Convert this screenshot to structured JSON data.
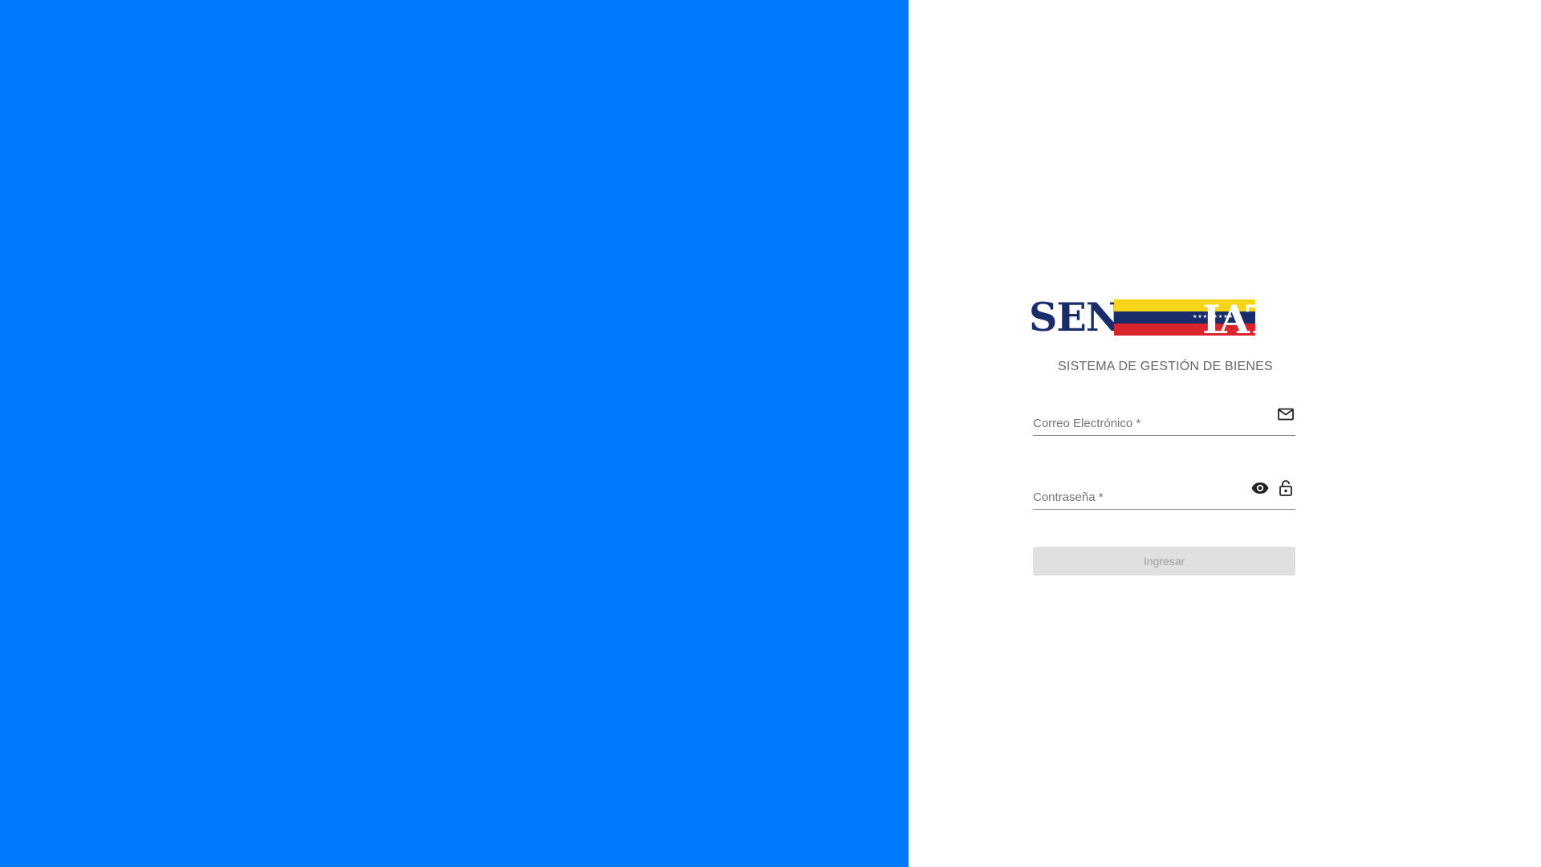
{
  "brand": {
    "logo_text_left": "SEN",
    "logo_text_right": "IAT",
    "logo_stars": "★★★★★★★★",
    "colors": {
      "navy": "#1a2d6b",
      "yellow": "#f7d417",
      "red": "#d9232d"
    }
  },
  "subtitle": "SISTEMA DE GESTIÓN DE BIENES",
  "form": {
    "email": {
      "label": "Correo Electrónico *",
      "value": "",
      "icon": "mail-icon"
    },
    "password": {
      "label": "Contraseña *",
      "value": "",
      "icons": [
        "eye-icon",
        "lock-icon"
      ]
    },
    "submit_label": "Ingresar"
  },
  "theme": {
    "left_panel_color": "#007bff",
    "button_disabled_bg": "#e0e0e0"
  }
}
